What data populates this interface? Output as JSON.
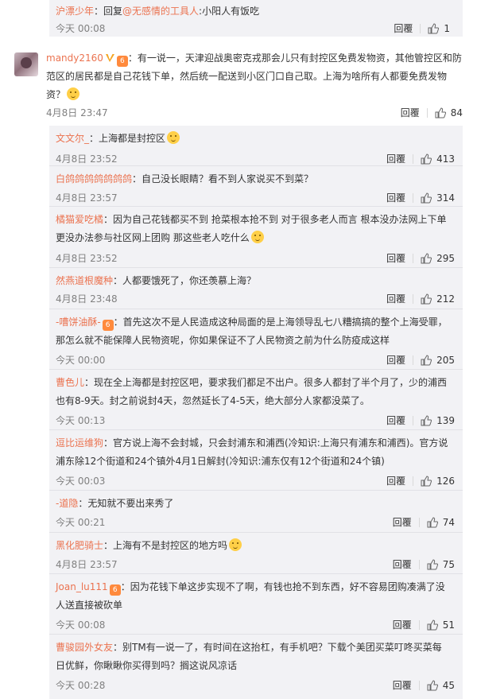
{
  "top_reply": {
    "user": "沪漂少年",
    "text_prefix": "：回复",
    "mention": "@无感情的工具人",
    "text": ":小阳人有饭吃",
    "time": "今天 00:08",
    "reply_label": "回覆",
    "likes": "1"
  },
  "main_comment": {
    "user": "mandy2160",
    "text": "：有一说一，天津迎战奥密克戎那会儿只有封控区免费发物资，其他管控区和防范区的居民都是自己花钱下单，然后统一配送到小区门口自己取。上海为啥所有人都要免费发物资？",
    "time": "4月8日 23:47",
    "reply_label": "回覆",
    "likes": "84"
  },
  "replies": [
    {
      "user": "文文尔_",
      "text": "：上海都是封控区",
      "time": "4月8日 23:52",
      "reply_label": "回覆",
      "likes": "413",
      "emoji": true
    },
    {
      "user": "白鸽鸽鸽鸽鸽鸽鸽",
      "text": "：自己没长眼睛？看不到人家说买不到菜？",
      "time": "4月8日 23:57",
      "reply_label": "回覆",
      "likes": "314"
    },
    {
      "user": "橘猫爱吃橘",
      "text": "：因为自己花钱都买不到 抢菜根本抢不到 对于很多老人而言 根本没办法网上下单 更没办法参与社区网上团购 那这些老人吃什么",
      "time": "4月8日 23:52",
      "reply_label": "回覆",
      "likes": "295",
      "emoji": true
    },
    {
      "user": "然燕道根魔种",
      "text": "：人都要饿死了，你还羡慕上海？",
      "time": "4月8日 23:48",
      "reply_label": "回覆",
      "likes": "212"
    },
    {
      "user": "-嘈饼油酥-",
      "text": "：首先这次不是人民造成这种局面的是上海领导乱七八糟搞搞的整个上海受罪，那怎么就不能保障人民物资呢，你如果保证不了人民物资之前为什么防疫成这样",
      "time": "今天 00:00",
      "reply_label": "回覆",
      "likes": "205",
      "level": "6"
    },
    {
      "user": "曹色儿",
      "text": "：现在全上海都是封控区吧，要求我们都足不出户。很多人都封了半个月了，少的浦西也有8-9天。封之前说封4天，忽然延长了4-5天，绝大部分人家都没菜了。",
      "time": "今天 00:13",
      "reply_label": "回覆",
      "likes": "139"
    },
    {
      "user": "逗比运维狗",
      "text": "：官方说上海不会封城，只会封浦东和浦西(冷知识:上海只有浦东和浦西)。官方说浦东除12个街道和24个镇外4月1日解封(冷知识:浦东仅有12个街道和24个镇)",
      "time": "今天 00:03",
      "reply_label": "回覆",
      "likes": "126"
    },
    {
      "user": "-道隐",
      "text": "：无知就不要出来秀了",
      "time": "今天 00:21",
      "reply_label": "回覆",
      "likes": "74"
    },
    {
      "user": "黑化肥骑士",
      "text": "：上海有不是封控区的地方吗",
      "time": "4月8日 23:57",
      "reply_label": "回覆",
      "likes": "75",
      "emoji": true
    },
    {
      "user": "Joan_lu111",
      "text": "：因为花钱下单这步实现不了啊，有钱也抢不到东西，好不容易团购凑满了没人送直接被砍单",
      "time": "今天 00:08",
      "reply_label": "回覆",
      "likes": "51",
      "level": "6"
    },
    {
      "user": "曹骏园外女友",
      "text": "：别TM有一说一了，有时间在这抬杠，有手机吧？下载个美团买菜叮咚买菜每日优鲜，你瞅瞅你买得到吗？搁这说风凉话",
      "time": "今天 00:28",
      "reply_label": "回覆",
      "likes": "45"
    }
  ]
}
